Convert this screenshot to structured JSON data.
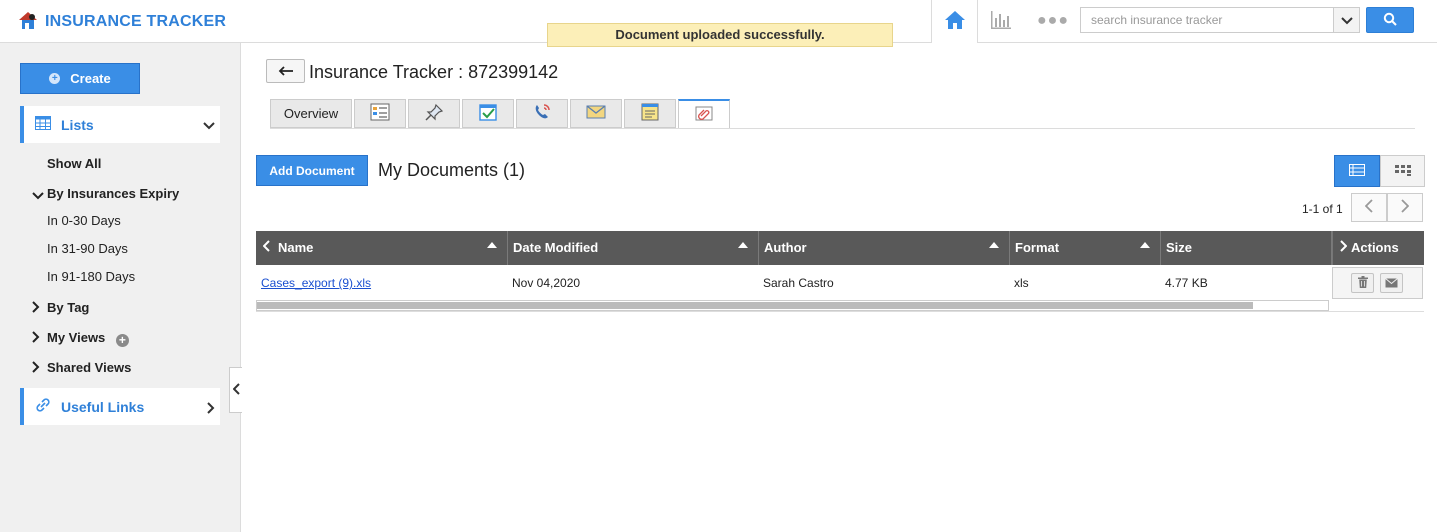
{
  "app": {
    "logo_text": "INSURANCE TRACKER",
    "accent_color": "#3a8ee6"
  },
  "toast": {
    "message": "Document uploaded successfully."
  },
  "topnav": {
    "icons": [
      "home-icon",
      "bar-chart-icon",
      "more-dots-icon"
    ],
    "search_placeholder": "search insurance tracker"
  },
  "sidebar": {
    "create_label": "Create",
    "lists_label": "Lists",
    "show_all": "Show All",
    "by_expiry": "By Insurances Expiry",
    "expiry_items": [
      "In 0-30 Days",
      "In 31-90 Days",
      "In 91-180 Days"
    ],
    "by_tag": "By Tag",
    "my_views": "My Views",
    "shared_views": "Shared Views",
    "useful_links": "Useful Links"
  },
  "main": {
    "title": "Insurance Tracker : 872399142",
    "tabs": [
      {
        "label": "Overview",
        "type": "text"
      },
      {
        "icon": "details-icon"
      },
      {
        "icon": "pin-icon"
      },
      {
        "icon": "task-check-icon"
      },
      {
        "icon": "call-icon"
      },
      {
        "icon": "mail-icon"
      },
      {
        "icon": "note-icon"
      },
      {
        "icon": "attachment-icon",
        "active": true
      }
    ],
    "add_document_label": "Add Document",
    "documents_title": "My Documents (1)",
    "pager": "1-1 of 1"
  },
  "table": {
    "columns": [
      "Name",
      "Date Modified",
      "Author",
      "Format",
      "Size",
      "Actions"
    ],
    "rows": [
      {
        "name": "Cases_export (9).xls",
        "date_modified": "Nov 04,2020",
        "author": "Sarah Castro",
        "format": "xls",
        "size": "4.77 KB"
      }
    ]
  }
}
